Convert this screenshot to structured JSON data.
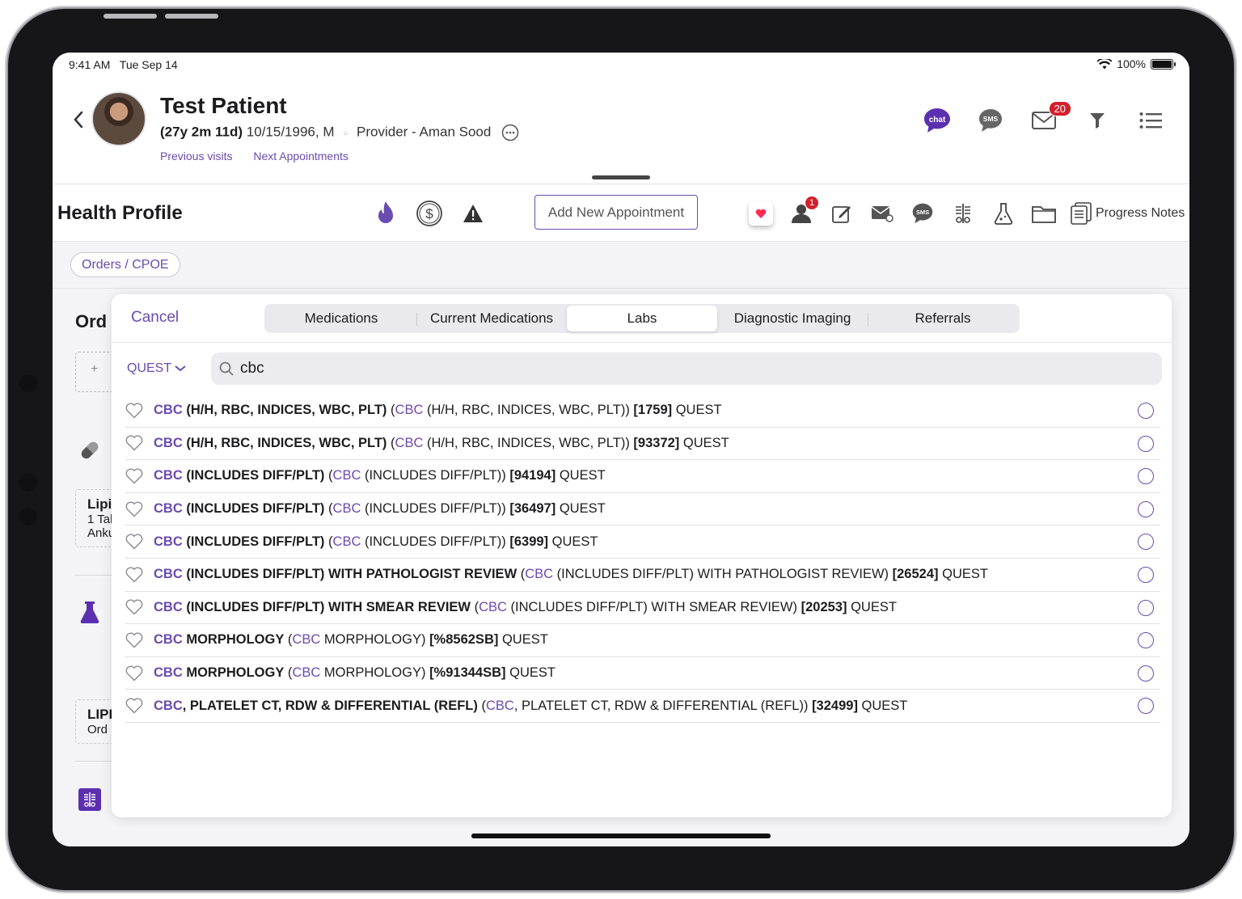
{
  "status": {
    "time": "9:41 AM",
    "date": "Tue Sep 14",
    "battery": "100%"
  },
  "patient": {
    "name": "Test Patient",
    "age": "(27y 2m 11d)",
    "dob_sex": "10/15/1996, M",
    "provider": "Provider - Aman Sood",
    "previous_visits": "Previous visits",
    "next_appointments": "Next Appointments"
  },
  "header_icons": {
    "chat": "chat",
    "sms": "SMS",
    "mail_badge": "20"
  },
  "toolbar": {
    "title": "Health Profile",
    "add_appointment": "Add New Appointment",
    "person_badge": "1",
    "progress_notes": "Progress Notes"
  },
  "orders_chip": "Orders / CPOE",
  "background": {
    "orders_heading": "Ord",
    "add": "+",
    "card1_line1": "Lipi",
    "card1_line2": "1 Tal",
    "card1_line3": "Anku",
    "card2_line1": "LIPI",
    "card2_line2": "Ord"
  },
  "panel": {
    "cancel": "Cancel",
    "tabs": [
      "Medications",
      "Current Medications",
      "Labs",
      "Diagnostic Imaging",
      "Referrals"
    ],
    "active_tab": "Labs",
    "lab_filter": "QUEST",
    "search_value": "cbc"
  },
  "results": [
    {
      "hl": "CBC",
      "rest": " (H/H, RBC, INDICES, WBC, PLT)",
      "paren_rest": " (H/H, RBC, INDICES, WBC, PLT))",
      "code": "[1759]",
      "lab": "QUEST"
    },
    {
      "hl": "CBC",
      "rest": " (H/H, RBC, INDICES, WBC, PLT)",
      "paren_rest": " (H/H, RBC, INDICES, WBC, PLT))",
      "code": "[93372]",
      "lab": "QUEST"
    },
    {
      "hl": "CBC",
      "rest": " (INCLUDES DIFF/PLT)",
      "paren_rest": " (INCLUDES DIFF/PLT))",
      "code": "[94194]",
      "lab": "QUEST"
    },
    {
      "hl": "CBC",
      "rest": " (INCLUDES DIFF/PLT)",
      "paren_rest": " (INCLUDES DIFF/PLT))",
      "code": "[36497]",
      "lab": "QUEST"
    },
    {
      "hl": "CBC",
      "rest": " (INCLUDES DIFF/PLT)",
      "paren_rest": " (INCLUDES DIFF/PLT))",
      "code": "[6399]",
      "lab": "QUEST"
    },
    {
      "hl": "CBC",
      "rest": " (INCLUDES DIFF/PLT) WITH PATHOLOGIST REVIEW",
      "paren_rest": " (INCLUDES DIFF/PLT) WITH PATHOLOGIST REVIEW)",
      "code": "[26524]",
      "lab": "QUEST"
    },
    {
      "hl": "CBC",
      "rest": " (INCLUDES DIFF/PLT) WITH SMEAR REVIEW",
      "paren_rest": " (INCLUDES DIFF/PLT) WITH SMEAR REVIEW)",
      "code": "[20253]",
      "lab": "QUEST"
    },
    {
      "hl": "CBC",
      "rest": " MORPHOLOGY",
      "paren_rest": " MORPHOLOGY)",
      "code": "[%8562SB]",
      "lab": "QUEST"
    },
    {
      "hl": "CBC",
      "rest": " MORPHOLOGY",
      "paren_rest": " MORPHOLOGY)",
      "code": "[%91344SB]",
      "lab": "QUEST"
    },
    {
      "hl": "CBC",
      "rest": ", PLATELET CT, RDW & DIFFERENTIAL (REFL)",
      "paren_rest": ", PLATELET CT, RDW & DIFFERENTIAL (REFL))",
      "code": "[32499]",
      "lab": "QUEST"
    }
  ],
  "colors": {
    "accent": "#6a4bb0",
    "badge": "#d31f2c"
  }
}
